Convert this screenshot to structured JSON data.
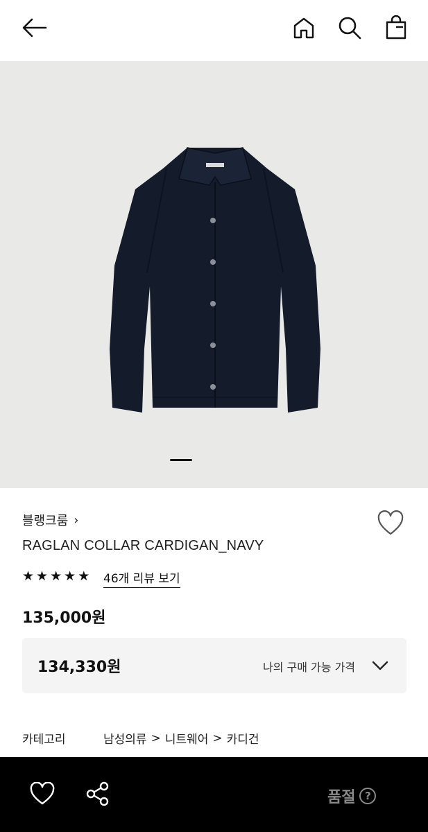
{
  "header": {
    "back_icon": "arrow-left-icon",
    "home_icon": "home-icon",
    "search_icon": "search-icon",
    "bag_icon": "shopping-bag-icon"
  },
  "gallery": {
    "current_index": 1,
    "indicator": "active"
  },
  "product": {
    "brand": "블랭크룸",
    "brand_chevron": "›",
    "name": "RAGLAN COLLAR CARDIGAN_NAVY",
    "rating_stars": 5,
    "review_link": "46개 리뷰 보기",
    "price": "135,000원"
  },
  "my_price": {
    "value": "134,330원",
    "label": "나의 구매 가능 가격"
  },
  "category": {
    "label": "카테고리",
    "path": [
      "남성의류",
      "니트웨어",
      "카디건"
    ],
    "separator": ">"
  },
  "bottom_bar": {
    "heart_icon": "heart-icon",
    "share_icon": "share-icon",
    "status": "품절",
    "help": "?"
  },
  "colors": {
    "hero_bg": "#e9e9e8",
    "garment": "#141b2b",
    "bottom_bar_bg": "#000000",
    "soldout_text": "#8a8a8a"
  }
}
